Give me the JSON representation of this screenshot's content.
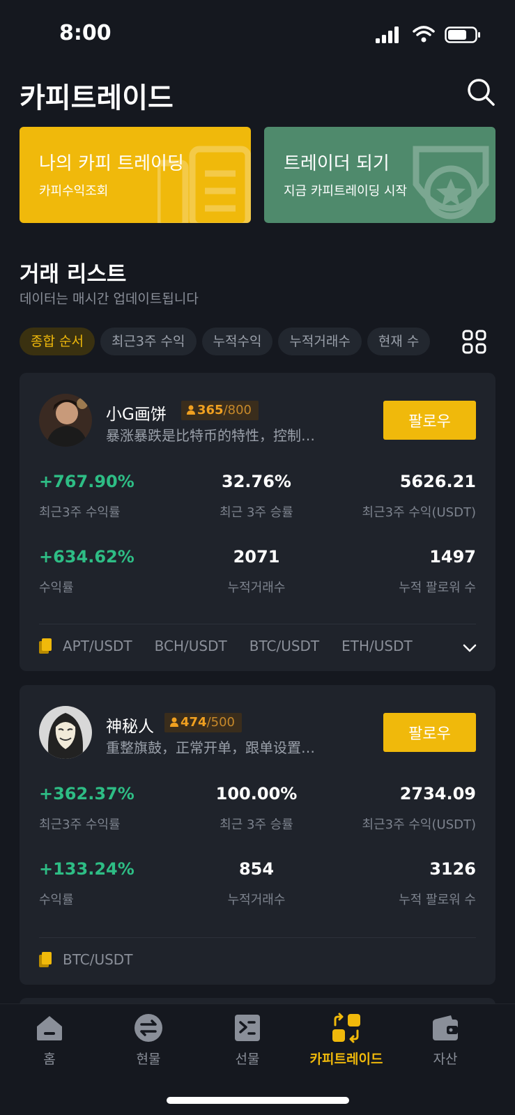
{
  "status_bar": {
    "time": "8:00"
  },
  "header": {
    "title": "카피트레이드",
    "search_icon": "search-icon"
  },
  "banners": [
    {
      "title": "나의 카피 트레이딩",
      "subtitle": "카피수익조회",
      "color": "#f0b90b",
      "icon": "document-icon"
    },
    {
      "title": "트레이더 되기",
      "subtitle": "지금 카피트레이딩 시작",
      "color": "#4f8a6c",
      "icon": "medal-icon"
    }
  ],
  "section": {
    "title": "거래 리스트",
    "subtitle": "데이터는 매시간 업데이트됩니다"
  },
  "filters": [
    "종합 순서",
    "최근3주 수익",
    "누적수익",
    "누적거래수",
    "현재 수"
  ],
  "active_filter_color": "#f0b90b",
  "follow_label": "팔로우",
  "stat_labels": {
    "roi_3w": "최근3주 수익률",
    "winrate_3w": "최근 3주 승률",
    "profit_3w": "최근3주 수익(USDT)",
    "roi": "수익률",
    "trades": "누적거래수",
    "followers": "누적 팔로워 수"
  },
  "traders": [
    {
      "name": "小G画饼",
      "followers_current": "365",
      "followers_max": "/800",
      "description": "暴涨暴跌是比特币的特性，控制…",
      "roi_3w": "+767.90%",
      "winrate_3w": "32.76%",
      "profit_3w": "5626.21",
      "roi": "+634.62%",
      "trades": "2071",
      "followers": "1497",
      "pairs": [
        "APT/USDT",
        "BCH/USDT",
        "BTC/USDT",
        "ETH/USDT"
      ]
    },
    {
      "name": "神秘人",
      "followers_current": "474",
      "followers_max": "/500",
      "description": "重整旗鼓，正常开单，跟单设置…",
      "roi_3w": "+362.37%",
      "winrate_3w": "100.00%",
      "profit_3w": "2734.09",
      "roi": "+133.24%",
      "trades": "854",
      "followers": "3126",
      "pairs": [
        "BTC/USDT"
      ]
    }
  ],
  "tabbar": [
    {
      "label": "홈",
      "icon": "home-icon"
    },
    {
      "label": "현물",
      "icon": "swap-icon"
    },
    {
      "label": "선물",
      "icon": "futures-icon"
    },
    {
      "label": "카피트레이드",
      "icon": "copy-trade-icon",
      "active": true
    },
    {
      "label": "자산",
      "icon": "wallet-icon"
    }
  ],
  "colors": {
    "background": "#15181f",
    "card": "#1f232b",
    "accent": "#f0b90b",
    "positive": "#2ebd85",
    "muted": "#8a8f99"
  }
}
